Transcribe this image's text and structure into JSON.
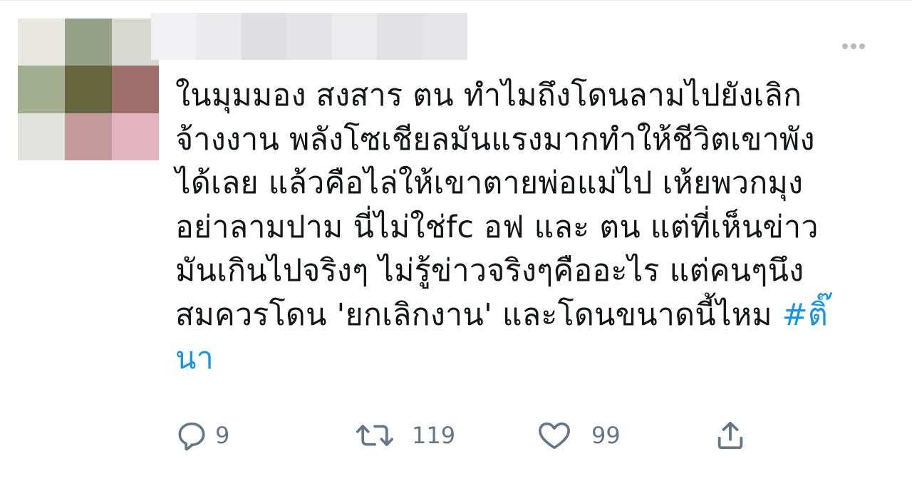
{
  "tweet": {
    "avatar_colors": [
      "#e8e8e0",
      "#97a187",
      "#d8d8d2",
      "#a3ad8f",
      "#66663f",
      "#9f6e6b",
      "#e2e2de",
      "#c49a9d",
      "#e3b6c1"
    ],
    "name_blur_colors": [
      "#f1f1f3",
      "#ebebed",
      "#dfdfe3",
      "#e4e4e8",
      "#ececee",
      "#e2e2e6",
      "#e6e6ea"
    ],
    "more_icon": "more-horizontal-icon",
    "text_lines": [
      "ในมุมมอง สงสาร ตน ทำไมถึงโดนลามไปยังเลิก",
      "จ้างงาน พลังโซเชียลมันแรงมากทำให้ชีวิตเขาพัง",
      "ได้เลย แล้วคือไล่ให้เขาตายพ่อแม่ไป เห้ยพวกมุง",
      "อย่าลามปาม นี่ไม่ใช่fc อฟ และ ตน แต่ที่เห็นข่าว",
      "มันเกินไปจริงๆ ไม่รู้ข่าวจริงๆคืออะไร แต่คนๆนึง",
      "สมควรโดน 'ยกเลิกงาน' และโดนขนาดนี้ไหม "
    ],
    "hashtag_part1": "#ติ๊",
    "hashtag_part2": "นา",
    "actions": {
      "reply": {
        "icon": "reply-icon",
        "count": "9"
      },
      "retweet": {
        "icon": "retweet-icon",
        "count": "119"
      },
      "like": {
        "icon": "heart-icon",
        "count": "99"
      },
      "share": {
        "icon": "share-icon"
      }
    },
    "colors": {
      "text": "#14171a",
      "hashtag": "#1b95e0",
      "icon": "#657786"
    }
  }
}
